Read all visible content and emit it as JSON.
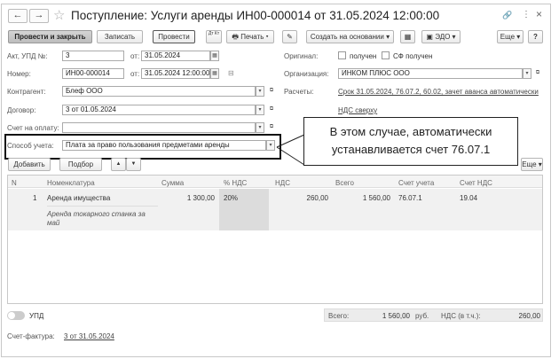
{
  "title": "Поступление: Услуги аренды ИН00-000014 от 31.05.2024 12:00:00",
  "nav": {
    "back": "←",
    "forward": "→",
    "star": "☆",
    "link": "🔗",
    "more": "⋮",
    "close": "×"
  },
  "toolbar": {
    "post_close": "Провести и закрыть",
    "save": "Записать",
    "post": "Провести",
    "dt_kt": "Дт Кт",
    "print": "Печать",
    "create_based": "Создать на основании",
    "edo": "ЭДО",
    "more": "Еще",
    "help": "?"
  },
  "form": {
    "act_label": "Акт, УПД №:",
    "act_value": "3",
    "act_from_label": "от:",
    "act_date": "31.05.2024",
    "original_label": "Оригинал:",
    "received_label": "получен",
    "sf_received_label": "СФ получен",
    "number_label": "Номер:",
    "number_value": "ИН00-000014",
    "number_from_label": "от:",
    "number_date": "31.05.2024 12:00:00",
    "org_label": "Организация:",
    "org_value": "ИНКОМ ПЛЮС ООО",
    "contractor_label": "Контрагент:",
    "contractor_value": "Блеф ООО",
    "settlements_label": "Расчеты:",
    "settlements_link": "Срок 31.05.2024, 76.07.2, 60.02, зачет аванса автоматически",
    "contract_label": "Договор:",
    "contract_value": "3 от 01.05.2024",
    "vat_link": "НДС сверху",
    "invoice_label": "Счет на оплату:",
    "invoice_value": "",
    "accounting_label": "Способ учета:",
    "accounting_value": "Плата за право пользования предметами аренды"
  },
  "callout": {
    "line1": "В этом случае, автоматически",
    "line2": "устанавливается счет 76.07.1"
  },
  "table_toolbar": {
    "add": "Добавить",
    "select": "Подбор",
    "up": "▲",
    "down": "▼",
    "more": "Еще"
  },
  "table": {
    "headers": [
      "N",
      "Номенклатура",
      "Сумма",
      "% НДС",
      "НДС",
      "Всего",
      "Счет учета",
      "Счет НДС"
    ],
    "rows": [
      {
        "n": "1",
        "item": "Аренда имущества",
        "sum": "1 300,00",
        "vat_rate": "20%",
        "vat": "260,00",
        "total": "1 560,00",
        "account": "76.07.1",
        "vat_account": "19.04",
        "description": "Аренда токарного станка за май"
      }
    ]
  },
  "footer": {
    "upd_label": "УПД",
    "total_label": "Всего:",
    "total_value": "1 560,00",
    "currency": "руб.",
    "vat_label": "НДС (в т.ч.):",
    "vat_value": "260,00",
    "invoice_label": "Счет-фактура:",
    "invoice_link": "3 от 31.05.2024"
  }
}
